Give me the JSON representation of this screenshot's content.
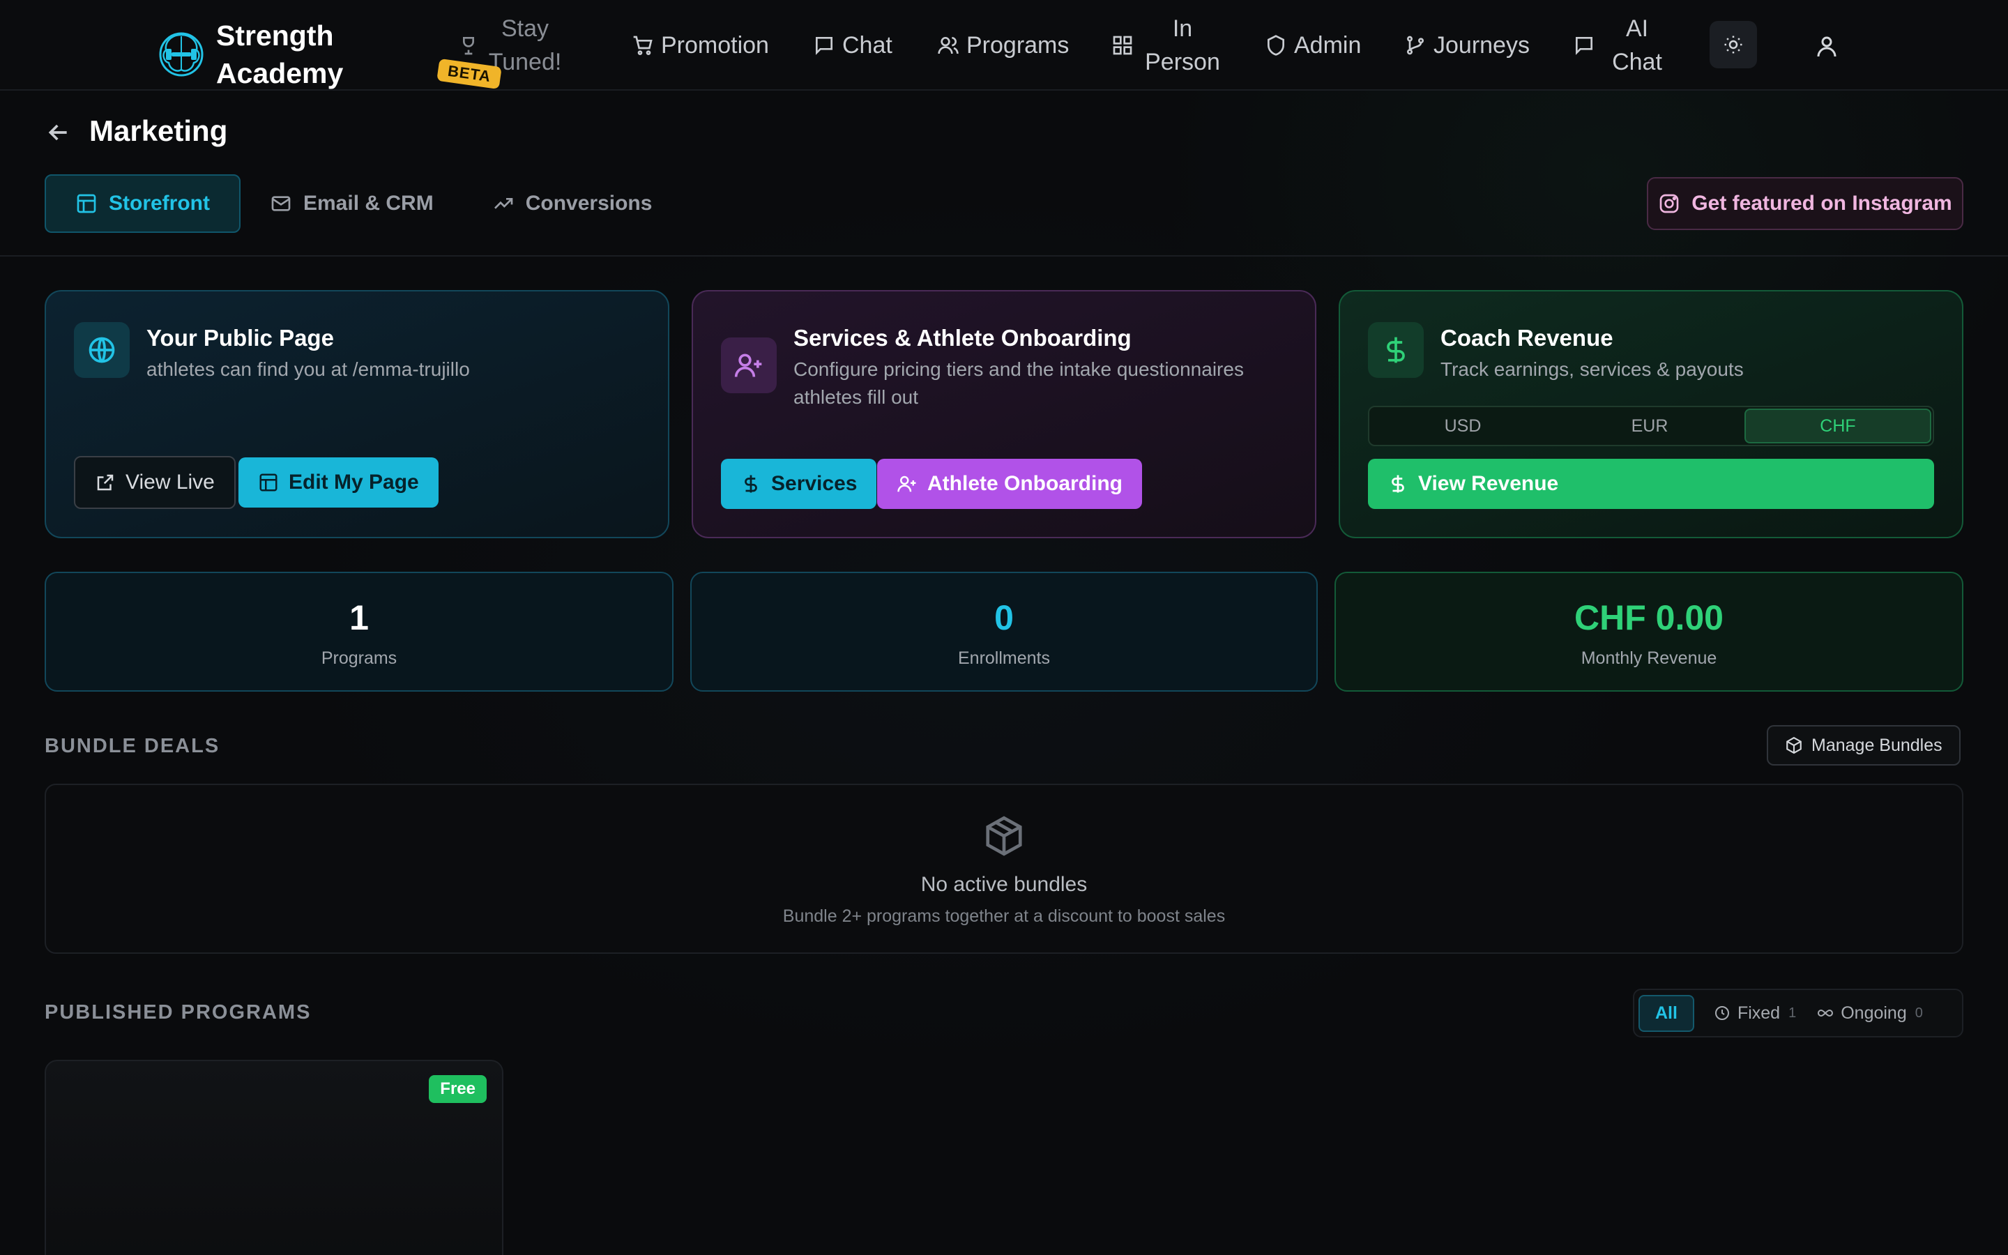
{
  "nav": {
    "brand": "Strength Academy",
    "items": [
      {
        "label": "Stay Tuned!",
        "icon": "trophy-icon"
      },
      {
        "label": "Promotion",
        "icon": "cart-icon"
      },
      {
        "label": "Chat",
        "icon": "message-icon"
      },
      {
        "label": "Programs",
        "icon": "users-icon"
      },
      {
        "label": "In Person",
        "icon": "grid-icon"
      },
      {
        "label": "Admin",
        "icon": "shield-icon"
      },
      {
        "label": "Journeys",
        "icon": "git-branch-icon"
      },
      {
        "label": "AI Chat",
        "icon": "message-icon"
      }
    ],
    "beta_badge": "BETA"
  },
  "page": {
    "title": "Marketing",
    "tabs": [
      {
        "label": "Storefront",
        "active": true
      },
      {
        "label": "Email & CRM",
        "active": false
      },
      {
        "label": "Conversions",
        "active": false
      }
    ],
    "instagram_button": "Get featured on Instagram"
  },
  "cards": {
    "public_page": {
      "title": "Your Public Page",
      "subtitle": "athletes can find you at /emma-trujillo",
      "view_live": "View Live",
      "edit": "Edit My Page"
    },
    "services": {
      "title": "Services & Athlete Onboarding",
      "subtitle": "Configure pricing tiers and the intake questionnaires athletes fill out",
      "services_btn": "Services",
      "onboarding_btn": "Athlete Onboarding"
    },
    "revenue": {
      "title": "Coach Revenue",
      "subtitle": "Track earnings, services & payouts",
      "currencies": [
        "USD",
        "EUR",
        "CHF"
      ],
      "selected_currency": "CHF",
      "view_btn": "View Revenue"
    }
  },
  "stats": [
    {
      "value": "1",
      "label": "Programs",
      "color": "#ffffff"
    },
    {
      "value": "0",
      "label": "Enrollments",
      "color": "#22c3e6"
    },
    {
      "value": "CHF 0.00",
      "label": "Monthly Revenue",
      "color": "#2fd178"
    }
  ],
  "bundles": {
    "section_title": "BUNDLE DEALS",
    "manage_btn": "Manage Bundles",
    "empty_title": "No active bundles",
    "empty_sub": "Bundle 2+ programs together at a discount to boost sales"
  },
  "published": {
    "section_title": "PUBLISHED PROGRAMS",
    "filters": [
      {
        "label": "All",
        "count": ""
      },
      {
        "label": "Fixed",
        "count": "1"
      },
      {
        "label": "Ongoing",
        "count": "0"
      }
    ],
    "program_badge": "Free"
  },
  "colors": {
    "accent_cyan": "#19b6d8",
    "accent_purple": "#b152e8",
    "accent_green": "#1fbf6a",
    "background": "#0a0b0d"
  }
}
